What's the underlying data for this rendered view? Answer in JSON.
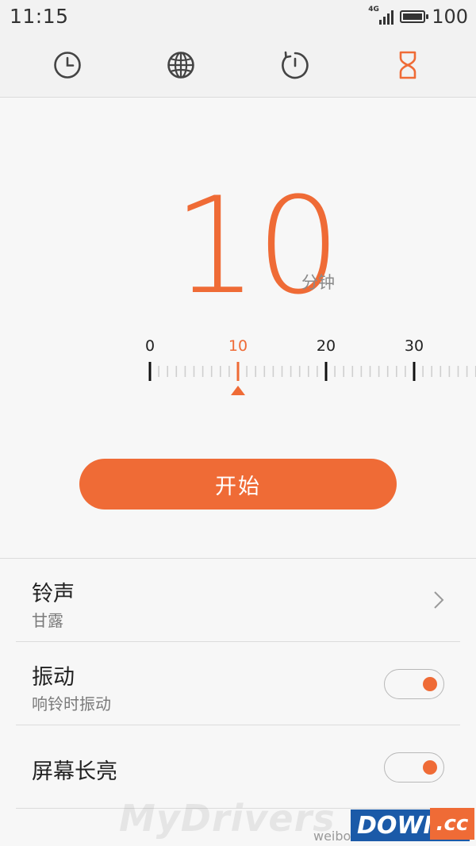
{
  "status_bar": {
    "time": "11:15",
    "network": "4G",
    "battery_percent": "100",
    "battery_level": 1.0
  },
  "tabs": [
    {
      "name": "alarm",
      "icon": "clock-icon",
      "active": false
    },
    {
      "name": "world-clock",
      "icon": "globe-icon",
      "active": false
    },
    {
      "name": "stopwatch",
      "icon": "stopwatch-icon",
      "active": false
    },
    {
      "name": "timer",
      "icon": "hourglass-icon",
      "active": true
    }
  ],
  "timer": {
    "value": "10",
    "unit": "分钟",
    "ruler_labels": [
      "0",
      "10",
      "20",
      "30"
    ],
    "selected_minutes": 10
  },
  "start_button": {
    "label": "开始"
  },
  "settings": {
    "ringtone": {
      "title": "铃声",
      "value": "甘露"
    },
    "vibrate": {
      "title": "振动",
      "subtitle": "响铃时振动",
      "enabled": true
    },
    "screen_on": {
      "title": "屏幕长亮",
      "enabled": true
    }
  },
  "watermark": {
    "brand": "MyDrivers",
    "weibo": "weibo",
    "logo_main": "DOWN",
    "logo_suffix": ".cc"
  },
  "colors": {
    "accent": "#ef6b36",
    "text_primary": "#222222",
    "text_secondary": "#7a7a7a",
    "icon_gray": "#444444",
    "background": "#f7f7f7"
  }
}
